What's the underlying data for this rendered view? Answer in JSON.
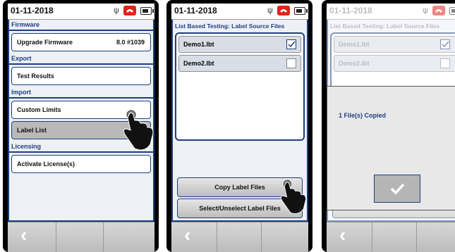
{
  "panel1": {
    "date": "01-11-2018",
    "firmware_header": "Firmware",
    "upgrade_label": "Upgrade Firmware",
    "upgrade_version": "8.0 #1039",
    "export_header": "Export",
    "test_results_label": "Test Results",
    "import_header": "Import",
    "custom_limits_label": "Custom Limits",
    "label_list_label": "Label List",
    "licensing_header": "Licensing",
    "activate_license_label": "Activate License(s)",
    "back_icon": "‹"
  },
  "panel2": {
    "date": "01-11-2018",
    "title": "List Based Testing: Label Source Files",
    "files": [
      {
        "name": "Demo1.lbt",
        "checked": true
      },
      {
        "name": "Demo2.lbt",
        "checked": false
      }
    ],
    "copy_button": "Copy  Label Files",
    "select_button": "Select/Unselect Label Files",
    "back_icon": "‹"
  },
  "panel3": {
    "date": "01-11-2018",
    "title": "List Based Testing: Label Source Files",
    "files": [
      {
        "name": "Demo1.lbt",
        "checked": true
      },
      {
        "name": "Demo2.lbt",
        "checked": false
      }
    ],
    "dialog_message": "1 File(s) Copied",
    "back_icon": "‹"
  },
  "icons": {
    "usb": "usb-icon",
    "phone": "phone-icon",
    "battery": "battery-icon",
    "check": "checkmark-icon",
    "hand": "pointing-hand-icon"
  },
  "colors": {
    "accent": "#1d3f7f",
    "phone_red": "#e2231a",
    "selected_row": "#b9b9b9"
  }
}
